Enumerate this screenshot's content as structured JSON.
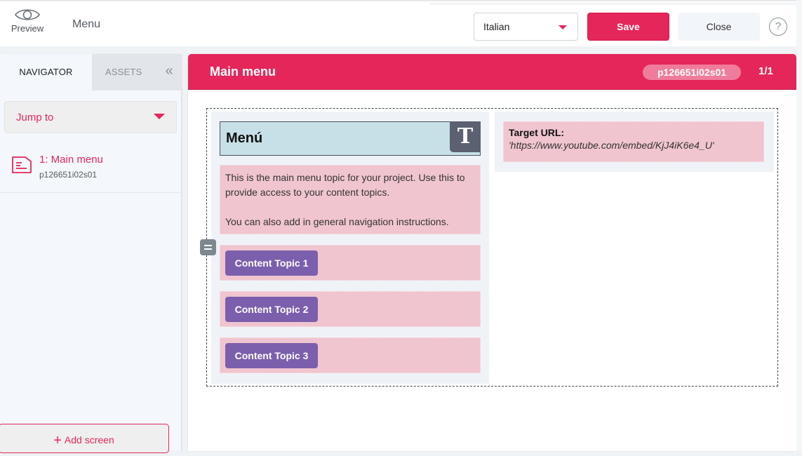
{
  "topbar": {
    "preview_label": "Preview",
    "title": "Menu",
    "language": "Italian",
    "save_label": "Save",
    "close_label": "Close",
    "help_label": "?"
  },
  "sidebar": {
    "tabs": [
      {
        "label": "NAVIGATOR",
        "active": true
      },
      {
        "label": "ASSETS",
        "active": false
      }
    ],
    "collapse_label": "«",
    "jump_to_label": "Jump to",
    "screens": [
      {
        "title": "1: Main menu",
        "id": "p126651i02s01"
      }
    ],
    "add_screen_label": "Add screen"
  },
  "main": {
    "title": "Main menu",
    "screen_id": "p126651i02s01",
    "page_count": "1/1",
    "heading": "Menú",
    "heading_icon": "T",
    "intro_paragraphs": [
      "This is the main menu topic for your project. Use this to provide access to your content topics.",
      "You can also add in general navigation instructions."
    ],
    "topics": [
      {
        "label": "Content Topic 1"
      },
      {
        "label": "Content Topic 2"
      },
      {
        "label": "Content Topic 3"
      }
    ],
    "target_url_label": "Target URL:",
    "target_url_value": "'https://www.youtube.com/embed/KjJ4iK6e4_U'"
  },
  "colors": {
    "accent": "#e5265a",
    "topic_button": "#7b5fad",
    "block_pink": "#f0c5cf",
    "heading_bg": "#c7e0e7"
  }
}
